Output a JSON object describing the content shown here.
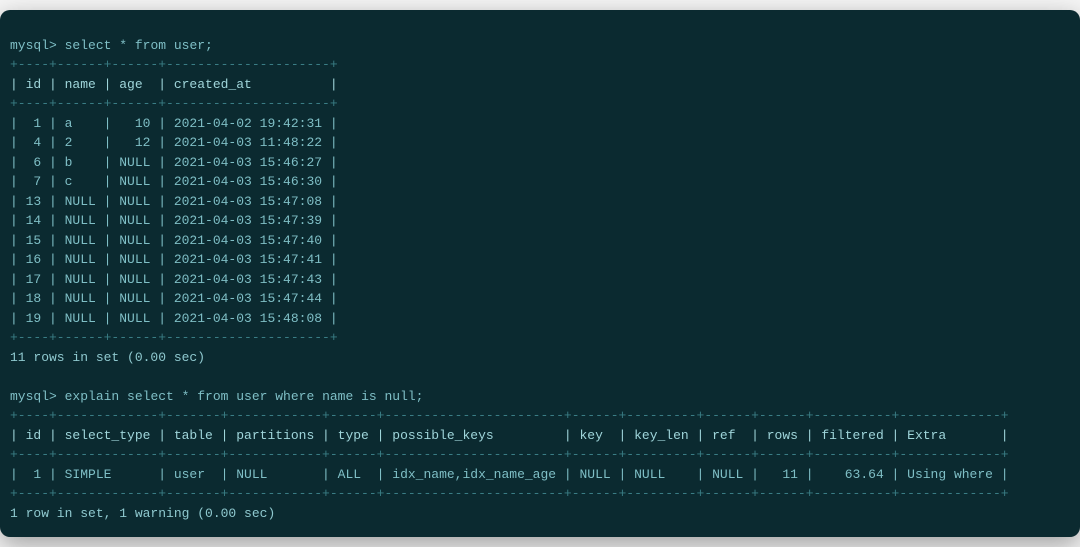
{
  "prompt": "mysql>",
  "query1": {
    "sql": "select * from user;",
    "columns": [
      "id",
      "name",
      "age",
      "created_at"
    ],
    "rows": [
      {
        "id": "1",
        "name": "a",
        "age": "10",
        "created_at": "2021-04-02 19:42:31"
      },
      {
        "id": "4",
        "name": "2",
        "age": "12",
        "created_at": "2021-04-03 11:48:22"
      },
      {
        "id": "6",
        "name": "b",
        "age": "NULL",
        "created_at": "2021-04-03 15:46:27"
      },
      {
        "id": "7",
        "name": "c",
        "age": "NULL",
        "created_at": "2021-04-03 15:46:30"
      },
      {
        "id": "13",
        "name": "NULL",
        "age": "NULL",
        "created_at": "2021-04-03 15:47:08"
      },
      {
        "id": "14",
        "name": "NULL",
        "age": "NULL",
        "created_at": "2021-04-03 15:47:39"
      },
      {
        "id": "15",
        "name": "NULL",
        "age": "NULL",
        "created_at": "2021-04-03 15:47:40"
      },
      {
        "id": "16",
        "name": "NULL",
        "age": "NULL",
        "created_at": "2021-04-03 15:47:41"
      },
      {
        "id": "17",
        "name": "NULL",
        "age": "NULL",
        "created_at": "2021-04-03 15:47:43"
      },
      {
        "id": "18",
        "name": "NULL",
        "age": "NULL",
        "created_at": "2021-04-03 15:47:44"
      },
      {
        "id": "19",
        "name": "NULL",
        "age": "NULL",
        "created_at": "2021-04-03 15:48:08"
      }
    ],
    "status": "11 rows in set (0.00 sec)"
  },
  "query2": {
    "sql": "explain select * from user where name is null;",
    "columns": [
      "id",
      "select_type",
      "table",
      "partitions",
      "type",
      "possible_keys",
      "key",
      "key_len",
      "ref",
      "rows",
      "filtered",
      "Extra"
    ],
    "rows": [
      {
        "id": "1",
        "select_type": "SIMPLE",
        "table": "user",
        "partitions": "NULL",
        "type": "ALL",
        "possible_keys": "idx_name,idx_name_age",
        "key": "NULL",
        "key_len": "NULL",
        "ref": "NULL",
        "rows": "11",
        "filtered": "63.64",
        "Extra": "Using where"
      }
    ],
    "status": "1 row in set, 1 warning (0.00 sec)"
  },
  "rules": {
    "q1_border": "+----+------+------+---------------------+",
    "q2_border": "+----+-------------+-------+------------+------+-----------------------+------+---------+------+------+----------+-------------+"
  },
  "headers_rendered": {
    "q1": "| id | name | age  | created_at          |",
    "q2": "| id | select_type | table | partitions | type | possible_keys         | key  | key_len | ref  | rows | filtered | Extra       |"
  },
  "rows_rendered": {
    "q1": [
      "|  1 | a    |   10 | 2021-04-02 19:42:31 |",
      "|  4 | 2    |   12 | 2021-04-03 11:48:22 |",
      "|  6 | b    | NULL | 2021-04-03 15:46:27 |",
      "|  7 | c    | NULL | 2021-04-03 15:46:30 |",
      "| 13 | NULL | NULL | 2021-04-03 15:47:08 |",
      "| 14 | NULL | NULL | 2021-04-03 15:47:39 |",
      "| 15 | NULL | NULL | 2021-04-03 15:47:40 |",
      "| 16 | NULL | NULL | 2021-04-03 15:47:41 |",
      "| 17 | NULL | NULL | 2021-04-03 15:47:43 |",
      "| 18 | NULL | NULL | 2021-04-03 15:47:44 |",
      "| 19 | NULL | NULL | 2021-04-03 15:48:08 |"
    ],
    "q2": [
      "|  1 | SIMPLE      | user  | NULL       | ALL  | idx_name,idx_name_age | NULL | NULL    | NULL |   11 |    63.64 | Using where |"
    ]
  }
}
